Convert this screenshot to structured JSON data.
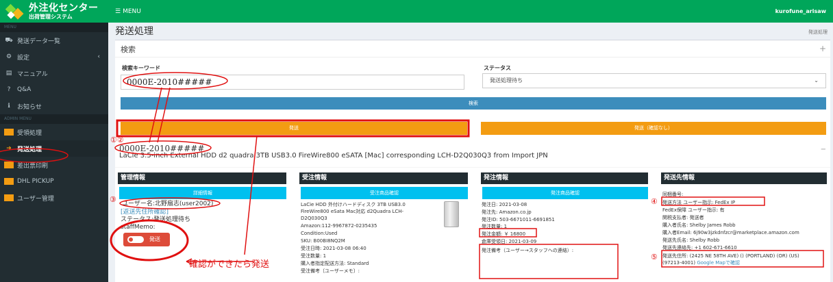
{
  "logo": {
    "title": "外注化センター",
    "subtitle": "出荷管理システム"
  },
  "topbar": {
    "menu_label": "MENU",
    "user": "kurofune_arisaw"
  },
  "sidebar": {
    "section1": "MENU",
    "section2": "ADMIN MENU",
    "items": [
      {
        "icon": "truck-icon",
        "label": "発送データ一覧"
      },
      {
        "icon": "gear-icon",
        "label": "設定"
      },
      {
        "icon": "book-icon",
        "label": "マニュアル"
      },
      {
        "icon": "question-icon",
        "label": "Q&A"
      },
      {
        "icon": "info-icon",
        "label": "お知らせ"
      }
    ],
    "admin_items": [
      {
        "icon": "hand-icon",
        "label": "受領処理"
      },
      {
        "icon": "arrow-right-icon",
        "label": "発送処理"
      },
      {
        "icon": "print-icon",
        "label": "差出票印刷"
      },
      {
        "icon": "print-icon",
        "label": "DHL PICKUP"
      },
      {
        "icon": "user-icon",
        "label": "ユーザー管理"
      }
    ]
  },
  "page": {
    "title": "発送処理",
    "breadcrumb": "発送処理"
  },
  "search": {
    "header": "検索",
    "keyword_label": "検索キーワード",
    "keyword_value": "0000E-2010#####",
    "status_label": "ステータス",
    "status_value": "発送処理待ち",
    "search_button": "検索",
    "ship_button": "発送",
    "ship_nocheck_button": "発送（確認なし）"
  },
  "order": {
    "id": "0000E-2010#####",
    "product_title": "LaCie 3.5-inch External HDD d2 quadra 3TB USB3.0 FireWire800 eSATA [Mac] corresponding LCH-D2Q030Q3 from Import JPN"
  },
  "mgmt": {
    "header": "管理情報",
    "button": "詳細情報",
    "user": "ユーザー名:北野扇志(user2002)",
    "link": "[返送先住所確認]",
    "status": "ステータス:発送処理待ち",
    "memo": "staffMemo:",
    "toggle_label": "発送"
  },
  "juchu": {
    "header": "受注情報",
    "button": "受注商品確認",
    "lines": [
      "LaCie HDD 外付けハードディスク 3TB USB3.0",
      "FireWire800 eSata Mac対応 d2Quadra LCH-",
      "D2Q030Q3",
      "Amazon:112-9967872-0235435",
      "Condition:Used",
      "SKU: B00BI8NQ2M",
      "受注日時: 2021-03-08 06:40",
      "受注数量: 1",
      "購入者指定配送方法: Standard",
      "受注備考〔ユーザーメモ〕:"
    ]
  },
  "hasso": {
    "header": "発注情報",
    "button": "発注商品確認",
    "lines": [
      "発注日: 2021-03-08",
      "発注先: Amazon.co.jp",
      "発注ID: 503-6671011-6691851",
      "発注数量: 1",
      "発注金額: ￥ 16800",
      "倉庫受領日: 2021-03-09",
      "発注備考（ユーザー→スタッフへの連絡）:"
    ]
  },
  "dest": {
    "header": "発送先情報",
    "lines": [
      "同梱番号:",
      "発送方法 ユーザー指示: FedEx IP",
      "FedEx保障 ユーザー指示: 有",
      "関税支払者: 発送者",
      "購入者氏名: Shelby James Robb",
      "購入者Email: 6j90w3jzkdnfzcr@marketplace.amazon.com",
      "発送先氏名: Shelby Robb",
      "発送先連絡先: +1 602-671-6610",
      "発送先住所: (2425 NE 58TH AVE) () (PORTLAND) (OR) (US)"
    ],
    "zip": "(97213-4001)",
    "map_link": "Google Mapで確認"
  },
  "annotations": {
    "n12": "①②",
    "n3": "③",
    "n4": "④",
    "n5": "⑤",
    "note": "確認ができたら発送"
  },
  "colors": {
    "green": "#00a65a",
    "sidebar": "#222d32",
    "blue": "#3c8dbc",
    "orange": "#f39c12",
    "cyan": "#00c0ef",
    "red": "#e01010"
  }
}
